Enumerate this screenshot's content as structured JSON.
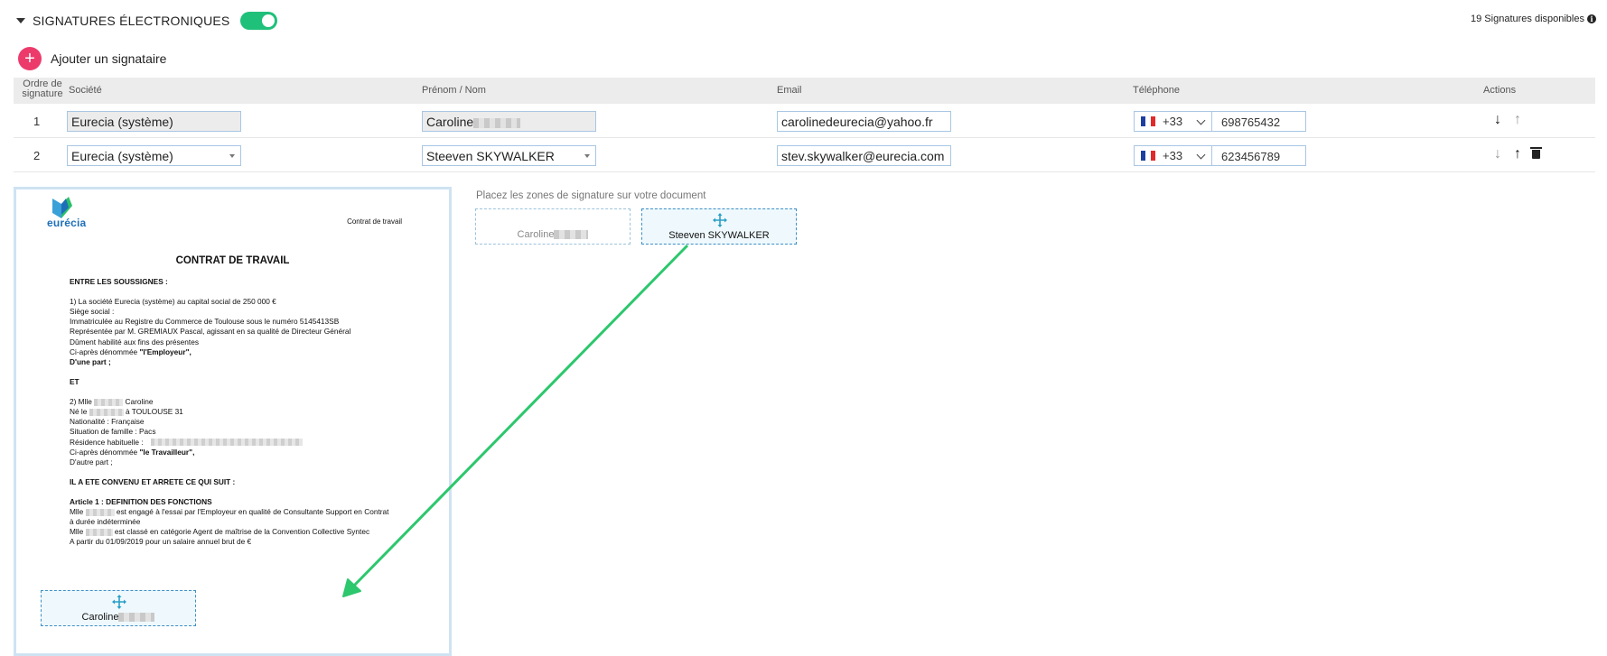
{
  "header": {
    "title": "SIGNATURES ÉLECTRONIQUES",
    "toggle_on": true,
    "available": "19 Signatures disponibles"
  },
  "add_signer_label": "Ajouter un signataire",
  "table": {
    "columns": {
      "order_line1": "Ordre de",
      "order_line2": "signature",
      "company": "Société",
      "name": "Prénom / Nom",
      "email": "Email",
      "phone": "Téléphone",
      "actions": "Actions"
    },
    "rows": [
      {
        "order": "1",
        "company": "Eurecia (système)",
        "name": "Caroline",
        "email": "carolinedeurecia@yahoo.fr",
        "dial_code": "+33",
        "phone": "698765432"
      },
      {
        "order": "2",
        "company": "Eurecia (système)",
        "name": "Steeven SKYWALKER",
        "email": "stev.skywalker@eurecia.com",
        "dial_code": "+33",
        "phone": "623456789"
      }
    ]
  },
  "document": {
    "logo": "eurécia",
    "header_right": "Contrat de travail",
    "title": "CONTRAT DE TRAVAIL",
    "l01": "ENTRE LES SOUSSIGNES :",
    "l02": "1) La société Eurecia (système) au capital social de 250 000 €",
    "l03": "Siège social :",
    "l04": "Immatriculée au Registre du Commerce de Toulouse sous le numéro 5145413SB",
    "l05": "Représentée par M. GREMIAUX Pascal, agissant en sa qualité de Directeur Général",
    "l06": "Dûment habilité aux fins des présentes",
    "l07a": "Ci-après dénommée ",
    "l07b": "\"l'Employeur\",",
    "l08": "D'une part ;",
    "l09": "ET",
    "l10a": "2) Mlle",
    "l10b": "Caroline",
    "l11a": "Né le",
    "l11b": "à TOULOUSE 31",
    "l12": "Nationalité : Française",
    "l13": "Situation de famille : Pacs",
    "l14": "Résidence habituelle :",
    "l15a": "Ci-après dénommée ",
    "l15b": "\"le Travailleur\",",
    "l16": "D'autre part ;",
    "l17": "IL A ETE CONVENU ET ARRETE CE QUI SUIT :",
    "l18": "Article 1 : DEFINITION DES FONCTIONS",
    "l19a": "Mlle",
    "l19b": "est engagé à l'essai par l'Employeur en qualité de Consultante Support en Contrat",
    "l20": "à durée indéterminée",
    "l21a": "Mlle",
    "l21b": "est classé en catégorie Agent de maîtrise de la Convention Collective Syntec",
    "l22": "A partir du 01/09/2019 pour un salaire annuel brut de  €"
  },
  "signature_panel": {
    "hint": "Placez les zones de signature sur votre document",
    "zone_caroline": "Caroline",
    "zone_steeven": "Steeven SKYWALKER",
    "placed_zone": "Caroline"
  },
  "colors": {
    "toggle": "#1fc07a",
    "add_button": "#ec3b6b",
    "drag_arrow": "#2dc76d",
    "zone_border": "#3d8fc6"
  },
  "icons": {
    "section": "caret-down-icon",
    "info": "info-icon",
    "add": "plus-icon",
    "down": "arrow-down-icon",
    "up": "arrow-up-icon",
    "delete": "trash-icon",
    "move": "move-icon",
    "flag": "flag-fr-icon"
  }
}
